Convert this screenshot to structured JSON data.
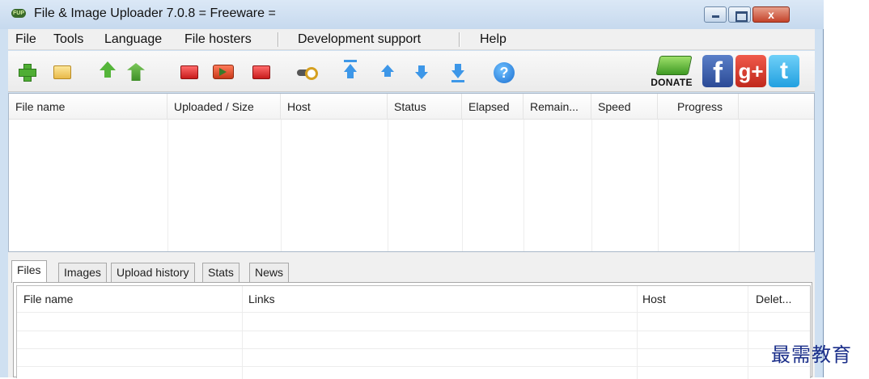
{
  "window": {
    "logo_text": "FUP",
    "title": "File & Image Uploader 7.0.8  = Freeware =",
    "close_glyph": "x"
  },
  "menu": [
    "File",
    "Tools",
    "Language",
    "File hosters",
    "Development support",
    "Help"
  ],
  "toolbar": {
    "donate_label": "DONATE",
    "facebook_glyph": "f",
    "googleplus_glyph": "g+",
    "twitter_glyph": "t",
    "help_glyph": "?"
  },
  "upload_list": {
    "columns": [
      "File name",
      "Uploaded / Size",
      "Host",
      "Status",
      "Elapsed",
      "Remain...",
      "Speed",
      "Progress"
    ]
  },
  "tabs": [
    "Files",
    "Images",
    "Upload history",
    "Stats",
    "News"
  ],
  "active_tab": "Files",
  "files_grid": {
    "columns": [
      "File name",
      "Links",
      "Host",
      "Delet..."
    ]
  },
  "watermark": "最需教育",
  "colors": {
    "title_bar": "#cfe0f1",
    "close_button": "#c4432a",
    "watermark": "#1b2f8a"
  }
}
